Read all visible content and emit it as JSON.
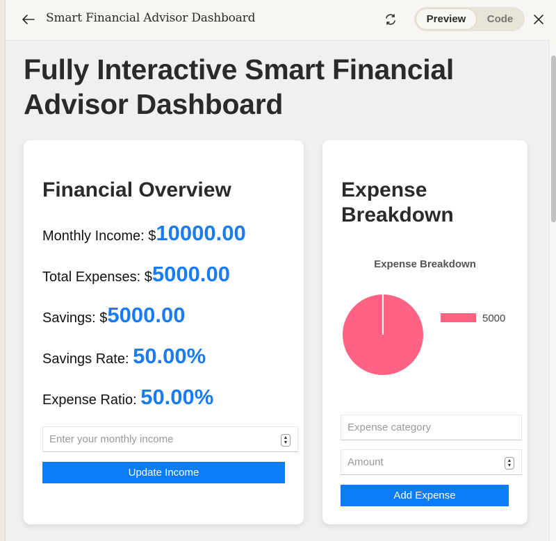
{
  "window": {
    "title": "Smart Financial Advisor Dashboard",
    "back_icon": "arrow-left-icon",
    "refresh_icon": "refresh-icon",
    "close_icon": "close-icon",
    "view_toggle": {
      "options": [
        "Preview",
        "Code"
      ],
      "selected": "Preview"
    }
  },
  "page": {
    "title": "Fully Interactive Smart Financial Advisor Dashboard"
  },
  "overview": {
    "heading": "Financial Overview",
    "stats": [
      {
        "label": "Monthly Income: $",
        "value": "10000.00"
      },
      {
        "label": "Total Expenses: $",
        "value": "5000.00"
      },
      {
        "label": "Savings: $",
        "value": "5000.00"
      },
      {
        "label": "Savings Rate: ",
        "value": "50.00%"
      },
      {
        "label": "Expense Ratio: ",
        "value": "50.00%"
      }
    ],
    "income_input": {
      "value": "",
      "placeholder": "Enter your monthly income"
    },
    "update_button": "Update Income"
  },
  "expense": {
    "heading": "Expense Breakdown",
    "category_input": {
      "value": "",
      "placeholder": "Expense category"
    },
    "amount_input": {
      "value": "",
      "placeholder": "Amount"
    },
    "add_button": "Add Expense"
  },
  "colors": {
    "accent": "#1a7cf0",
    "button": "#0d7cf8",
    "pie_slice": "#ff6384"
  },
  "chart_data": {
    "type": "pie",
    "title": "Expense Breakdown",
    "categories": [
      "5000"
    ],
    "values": [
      5000
    ],
    "colors": [
      "#ff6384"
    ],
    "legend": "right"
  }
}
